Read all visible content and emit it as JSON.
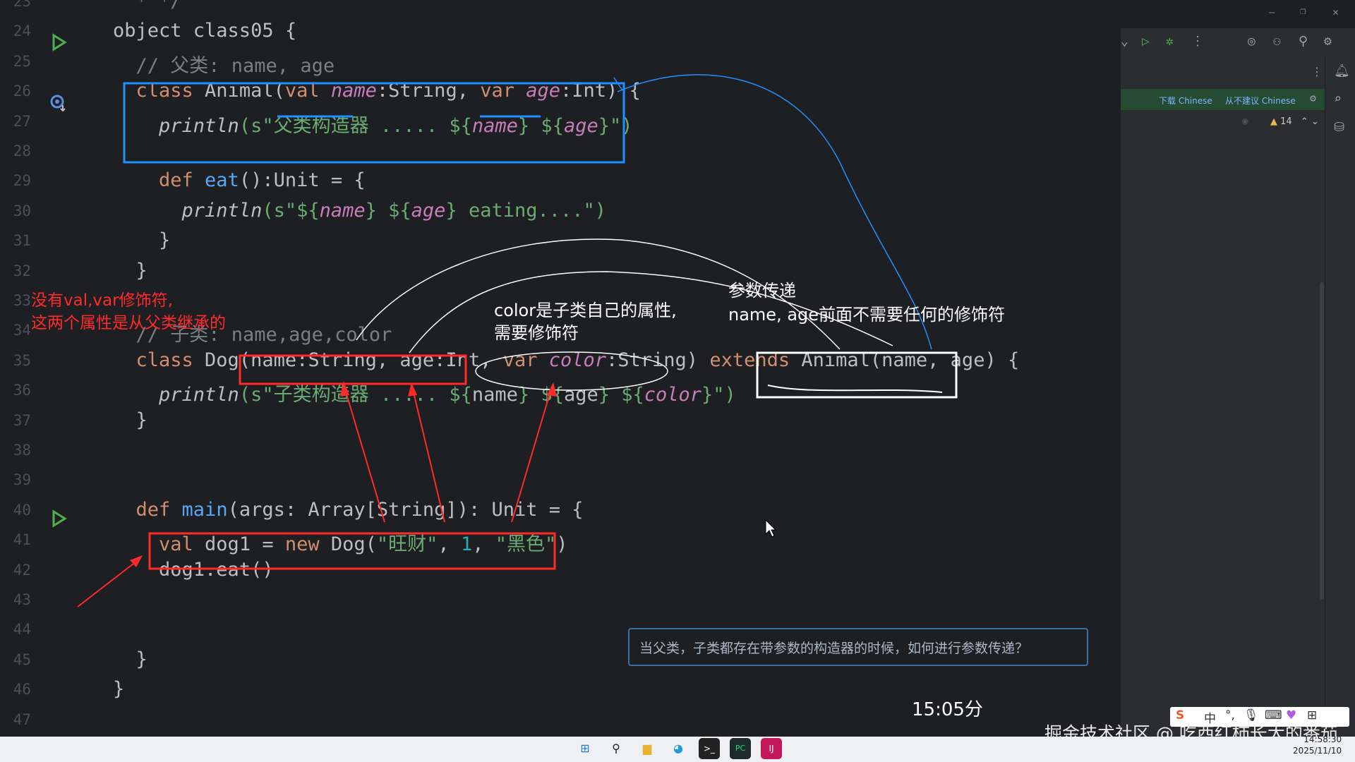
{
  "editor": {
    "lines": [
      {
        "num": "23",
        "tokens": [
          {
            "t": "  * */",
            "c": "cm"
          }
        ]
      },
      {
        "num": "24",
        "tokens": [
          {
            "t": "object class05 {",
            "c": ""
          }
        ]
      },
      {
        "num": "25",
        "tokens": [
          {
            "t": "  // 父类: name, age",
            "c": "cm"
          }
        ]
      },
      {
        "num": "26",
        "tokens": [
          {
            "t": "  class ",
            "c": "kw"
          },
          {
            "t": "Animal(",
            "c": ""
          },
          {
            "t": "val ",
            "c": "kw"
          },
          {
            "t": "name",
            "c": "pn"
          },
          {
            "t": ":String, ",
            "c": ""
          },
          {
            "t": "var ",
            "c": "kw"
          },
          {
            "t": "age",
            "c": "pn"
          },
          {
            "t": ":Int) {",
            "c": ""
          }
        ]
      },
      {
        "num": "27",
        "tokens": [
          {
            "t": "    println",
            "c": "it"
          },
          {
            "t": "(s\"父类构造器 ..... ${",
            "c": "st"
          },
          {
            "t": "name",
            "c": "pn"
          },
          {
            "t": "} ${",
            "c": "st"
          },
          {
            "t": "age",
            "c": "pn"
          },
          {
            "t": "}\")",
            "c": "st"
          }
        ]
      },
      {
        "num": "28",
        "tokens": [
          {
            "t": "",
            "c": ""
          }
        ]
      },
      {
        "num": "29",
        "tokens": [
          {
            "t": "    def ",
            "c": "kw"
          },
          {
            "t": "eat",
            "c": "fn"
          },
          {
            "t": "():Unit = {",
            "c": ""
          }
        ]
      },
      {
        "num": "30",
        "tokens": [
          {
            "t": "      println",
            "c": "it"
          },
          {
            "t": "(s\"${",
            "c": "st"
          },
          {
            "t": "name",
            "c": "pn"
          },
          {
            "t": "} ${",
            "c": "st"
          },
          {
            "t": "age",
            "c": "pn"
          },
          {
            "t": "} eating....\")",
            "c": "st"
          }
        ]
      },
      {
        "num": "31",
        "tokens": [
          {
            "t": "    }",
            "c": ""
          }
        ]
      },
      {
        "num": "32",
        "tokens": [
          {
            "t": "  }",
            "c": ""
          }
        ]
      },
      {
        "num": "33",
        "tokens": [
          {
            "t": "",
            "c": ""
          }
        ]
      },
      {
        "num": "34",
        "tokens": [
          {
            "t": "  // 子类: name,age,color",
            "c": "cm"
          }
        ]
      },
      {
        "num": "35",
        "tokens": [
          {
            "t": "  class ",
            "c": "kw"
          },
          {
            "t": "Dog(name:String, age:Int, ",
            "c": ""
          },
          {
            "t": "var ",
            "c": "kw"
          },
          {
            "t": "color",
            "c": "pn"
          },
          {
            "t": ":String) ",
            "c": ""
          },
          {
            "t": "extends ",
            "c": "kw"
          },
          {
            "t": "Animal(name, age) {",
            "c": ""
          }
        ]
      },
      {
        "num": "36",
        "tokens": [
          {
            "t": "    println",
            "c": "it"
          },
          {
            "t": "(s\"子类构造器 ..... ${",
            "c": "st"
          },
          {
            "t": "name",
            "c": ""
          },
          {
            "t": "} ${",
            "c": "st"
          },
          {
            "t": "age",
            "c": ""
          },
          {
            "t": "} ${",
            "c": "st"
          },
          {
            "t": "color",
            "c": "pn"
          },
          {
            "t": "}\")",
            "c": "st"
          }
        ]
      },
      {
        "num": "37",
        "tokens": [
          {
            "t": "  }",
            "c": ""
          }
        ]
      },
      {
        "num": "38",
        "tokens": [
          {
            "t": "",
            "c": ""
          }
        ]
      },
      {
        "num": "39",
        "tokens": [
          {
            "t": "",
            "c": ""
          }
        ]
      },
      {
        "num": "40",
        "tokens": [
          {
            "t": "  def ",
            "c": "kw"
          },
          {
            "t": "main",
            "c": "fn"
          },
          {
            "t": "(args: Array[String]): Unit = {",
            "c": ""
          }
        ]
      },
      {
        "num": "41",
        "tokens": [
          {
            "t": "    val ",
            "c": "kw"
          },
          {
            "t": "dog1 = ",
            "c": ""
          },
          {
            "t": "new ",
            "c": "kw"
          },
          {
            "t": "Dog(",
            "c": ""
          },
          {
            "t": "\"旺财\"",
            "c": "st"
          },
          {
            "t": ", ",
            "c": ""
          },
          {
            "t": "1",
            "c": "nm"
          },
          {
            "t": ", ",
            "c": ""
          },
          {
            "t": "\"黑色\"",
            "c": "st"
          },
          {
            "t": ")",
            "c": ""
          }
        ]
      },
      {
        "num": "42",
        "tokens": [
          {
            "t": "    dog1.eat()",
            "c": ""
          }
        ]
      },
      {
        "num": "43",
        "tokens": [
          {
            "t": "",
            "c": ""
          }
        ]
      },
      {
        "num": "44",
        "tokens": [
          {
            "t": "",
            "c": ""
          }
        ]
      },
      {
        "num": "45",
        "tokens": [
          {
            "t": "  }",
            "c": ""
          }
        ]
      },
      {
        "num": "46",
        "tokens": [
          {
            "t": "}",
            "c": ""
          }
        ]
      },
      {
        "num": "47",
        "tokens": [
          {
            "t": "",
            "c": ""
          }
        ]
      }
    ]
  },
  "annotations": {
    "red_note_1": "没有val,var修饰符,",
    "red_note_2": "这两个属性是从父类继承的",
    "white_note_1a": "color是子类自己的属性,",
    "white_note_1b": "需要修饰符",
    "white_note_2a": "参数传递",
    "white_note_2b": "name, age前面不需要任何的修饰符",
    "question": "当父类，子类都存在带参数的构造器的时候，如何进行参数传递？",
    "time": "15:05分",
    "watermark": "掘金技术社区 @ 吃西红柿长大的番茄"
  },
  "right_panel": {
    "translate_download": "下载 Chinese",
    "translate_dismiss": "从不建议 Chinese",
    "warning_count": "14"
  },
  "taskbar": {
    "clock_time": "14:58:30",
    "clock_date": "2025/11/10",
    "ime_label": "中"
  },
  "colors": {
    "accent_blue": "#1e90ff",
    "annotation_red": "#ff2a2a",
    "run_green": "#4caf50"
  }
}
